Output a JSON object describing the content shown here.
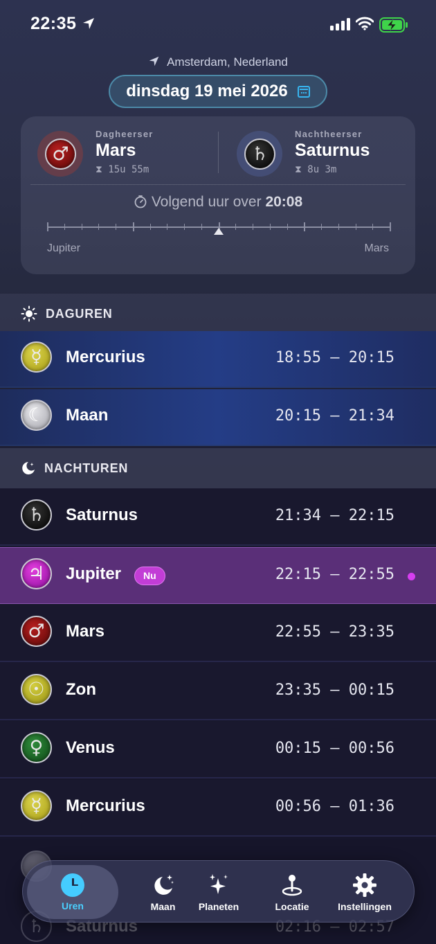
{
  "status_bar": {
    "time": "22:35"
  },
  "header": {
    "location": "Amsterdam, Nederland",
    "date": "dinsdag 19 mei 2026"
  },
  "rulers": {
    "day": {
      "label": "Dagheerser",
      "planet": "Mars",
      "symbol": "♂",
      "duration": "15u 55m"
    },
    "night": {
      "label": "Nachtheerser",
      "planet": "Saturnus",
      "symbol": "♄",
      "duration": "8u 3m"
    }
  },
  "next_hour": {
    "prefix": "Volgend uur over",
    "time": "20:08"
  },
  "timeline": {
    "left_label": "Jupiter",
    "right_label": "Mars",
    "marker_fraction": 0.5
  },
  "sections": {
    "day": {
      "title": "DAGUREN"
    },
    "night": {
      "title": "NACHTUREN"
    }
  },
  "day_hours": [
    {
      "name": "Mercurius",
      "symbol": "☿",
      "time": "18:55 – 20:15",
      "icon": "mercury"
    },
    {
      "name": "Maan",
      "symbol": "☾",
      "time": "20:15 – 21:34",
      "icon": "moon"
    }
  ],
  "night_hours": [
    {
      "name": "Saturnus",
      "symbol": "♄",
      "time": "21:34 – 22:15",
      "icon": "saturn"
    },
    {
      "name": "Jupiter",
      "symbol": "♃",
      "time": "22:15 – 22:55",
      "icon": "jupiter",
      "badge": "Nu"
    },
    {
      "name": "Mars",
      "symbol": "♂",
      "time": "22:55 – 23:35",
      "icon": "mars"
    },
    {
      "name": "Zon",
      "symbol": "☉",
      "time": "23:35 – 00:15",
      "icon": "sun"
    },
    {
      "name": "Venus",
      "symbol": "♀",
      "time": "00:15 – 00:56",
      "icon": "venus"
    },
    {
      "name": "Mercurius",
      "symbol": "☿",
      "time": "00:56 – 01:36",
      "icon": "mercury"
    }
  ],
  "partial_row": {
    "name": "Saturnus",
    "symbol": "♄",
    "time": "02:16 – 02:57"
  },
  "tabs": [
    {
      "label": "Uren",
      "active": true
    },
    {
      "label": "Maan"
    },
    {
      "label": "Planeten"
    },
    {
      "label": "Locatie"
    },
    {
      "label": "Instellingen"
    }
  ],
  "colors": {
    "accent": "#45ccff",
    "current_row": "#5a2f78",
    "now_badge": "#c23dd6"
  }
}
